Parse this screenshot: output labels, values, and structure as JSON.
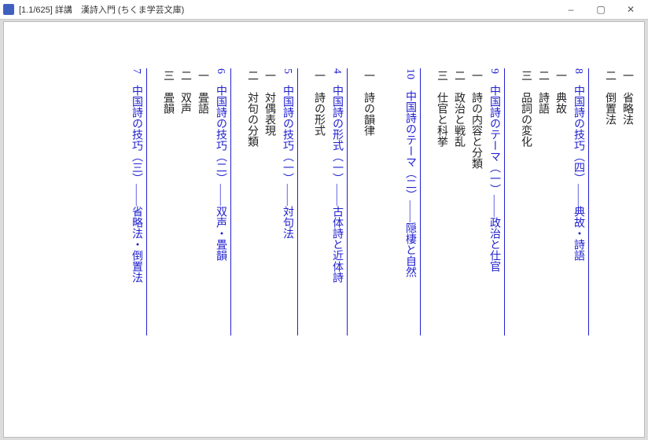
{
  "window": {
    "title": "[1.1/625]  詳講　漢詩入門 (ちくま学芸文庫)",
    "minimize": "–",
    "maximize": "▢",
    "close": "✕"
  },
  "toc": {
    "pre_a": {
      "num": "一",
      "label": "省略法"
    },
    "pre_b": {
      "num": "二",
      "label": "倒置法"
    },
    "h8": {
      "num": "8",
      "title": "中国詩の技巧（四）――典故・詩語"
    },
    "h8_1": {
      "num": "一",
      "label": "典故"
    },
    "h8_2": {
      "num": "二",
      "label": "詩語"
    },
    "h8_3": {
      "num": "三",
      "label": "品詞の変化"
    },
    "h9": {
      "num": "9",
      "title": "中国詩のテーマ（一）――政治と仕官"
    },
    "h9_1": {
      "num": "一",
      "label": "詩の内容と分類"
    },
    "h9_2": {
      "num": "二",
      "label": "政治と戦乱"
    },
    "h9_3": {
      "num": "三",
      "label": "仕官と科挙"
    },
    "h10": {
      "num": "10",
      "title": "中国詩のテーマ（二）――隠棲と自然"
    },
    "h4_a": {
      "num": "一",
      "label": "詩の韻律"
    },
    "h4": {
      "num": "4",
      "title": "中国詩の形式（一）――古体詩と近体詩"
    },
    "h4_1": {
      "num": "一",
      "label": "詩の形式"
    },
    "h5": {
      "num": "5",
      "title": "中国詩の技巧（一）――対句法"
    },
    "h5_1": {
      "num": "一",
      "label": "対偶表現"
    },
    "h5_2": {
      "num": "二",
      "label": "対句の分類"
    },
    "h6": {
      "num": "6",
      "title": "中国詩の技巧（二）――双声・畳韻"
    },
    "h6_1": {
      "num": "一",
      "label": "畳語"
    },
    "h6_2": {
      "num": "二",
      "label": "双声"
    },
    "h6_3": {
      "num": "三",
      "label": "畳韻"
    },
    "h7": {
      "num": "7",
      "title": "中国詩の技巧（三）――省略法・倒置法"
    }
  }
}
